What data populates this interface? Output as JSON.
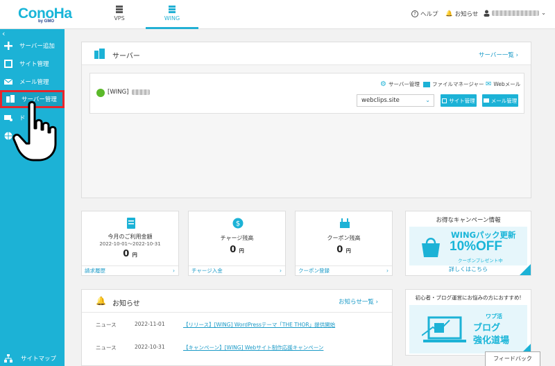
{
  "header": {
    "logo": "ConoHa",
    "logo_sub": "by GMO",
    "tabs": [
      {
        "label": "VPS",
        "icon": "server-icon"
      },
      {
        "label": "WING",
        "icon": "server-icon",
        "active": true
      }
    ],
    "help": "ヘルプ",
    "news": "お知らせ"
  },
  "sidebar": {
    "items": [
      {
        "label": "サーバー追加",
        "icon": "plus-icon"
      },
      {
        "label": "サイト管理",
        "icon": "window-icon"
      },
      {
        "label": "メール管理",
        "icon": "mail-icon"
      },
      {
        "label": "サーバー管理",
        "icon": "server-stack-icon",
        "highlighted": true
      },
      {
        "label": "ド",
        "icon": "domain-icon"
      },
      {
        "label": "",
        "icon": "globe-icon"
      }
    ],
    "sitemap": "サイトマップ"
  },
  "server_panel": {
    "title": "サーバー",
    "more_link": "サーバー一覧",
    "server_name": "[WING]",
    "tools": [
      "サーバー管理",
      "ファイルマネージャー",
      "Webメール"
    ],
    "domain": "webclips.site",
    "site_button": "サイト管理",
    "mail_button": "メール管理"
  },
  "cards": [
    {
      "title": "今月のご利用金額",
      "date": "2022-10-01～2022-10-31",
      "value": "0",
      "unit": "円",
      "footer": "請求履歴"
    },
    {
      "title": "チャージ残高",
      "value": "0",
      "unit": "円",
      "footer": "チャージ入金"
    },
    {
      "title": "クーポン残高",
      "value": "0",
      "unit": "円",
      "footer": "クーポン登録"
    }
  ],
  "banner1": {
    "title": "お得なキャンペーン情報",
    "line1": "WINGパック更新",
    "line2": "10%OFF",
    "line3": "クーポンプレゼント中",
    "footer": "詳しくはこちら"
  },
  "banner2": {
    "title": "初心者・ブログ運営にお悩みの方におすすめ!",
    "line1": "ワプ活",
    "line2": "ブログ",
    "line3": "強化道場"
  },
  "news_panel": {
    "title": "お知らせ",
    "more_link": "お知らせ一覧",
    "rows": [
      {
        "category": "ニュース",
        "date": "2022-11-01",
        "title": "【リリース】[WING] WordPressテーマ「THE THOR」提供開始"
      },
      {
        "category": "ニュース",
        "date": "2022-10-31",
        "title": "【キャンペーン】[WING] Webサイト制作応援キャンペーン"
      }
    ]
  },
  "feedback": "フィードバック",
  "colors": {
    "accent": "#1cb2d6",
    "highlight": "#e8252b",
    "power_on": "#5bb92a"
  }
}
